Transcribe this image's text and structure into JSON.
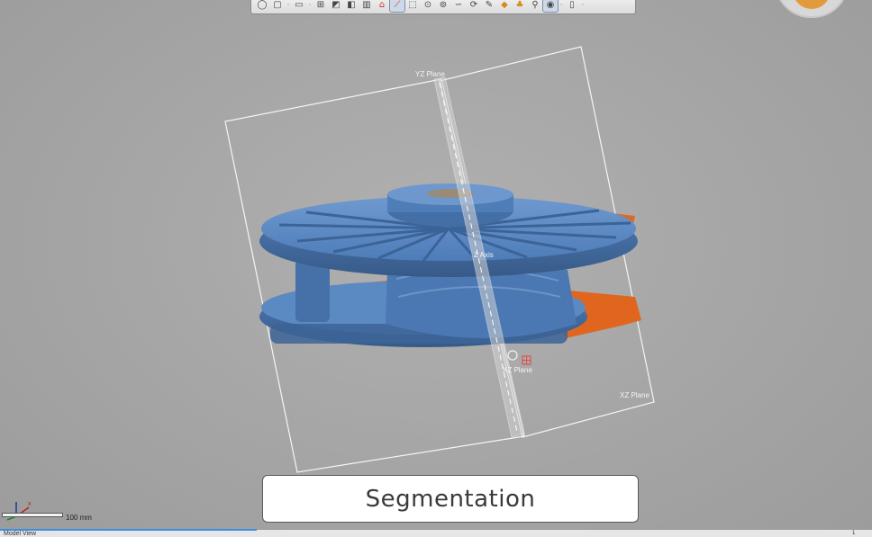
{
  "toolbar": {
    "buttons": [
      {
        "name": "sphere-view-icon",
        "glyph": "◯"
      },
      {
        "name": "cube-view-icon",
        "glyph": "▢"
      },
      {
        "name": "dropdown-dot",
        "glyph": "·"
      },
      {
        "name": "box-select-icon",
        "glyph": "▭"
      },
      {
        "name": "dropdown-dot",
        "glyph": "·"
      },
      {
        "name": "plane-view-icon",
        "glyph": "⊞"
      },
      {
        "name": "section-icon",
        "glyph": "◩"
      },
      {
        "name": "split-view-icon",
        "glyph": "◧"
      },
      {
        "name": "column-view-icon",
        "glyph": "▥"
      },
      {
        "name": "house-icon",
        "glyph": "⌂"
      },
      {
        "name": "slash-tool-icon",
        "glyph": "⟋"
      },
      {
        "name": "rect-select-icon",
        "glyph": "⬚"
      },
      {
        "name": "point-target-icon",
        "glyph": "⊙"
      },
      {
        "name": "circle-dot-icon",
        "glyph": "⊚"
      },
      {
        "name": "lasso-icon",
        "glyph": "∽"
      },
      {
        "name": "paint-brush-icon",
        "glyph": "⟳"
      },
      {
        "name": "pen-edit-icon",
        "glyph": "✎"
      },
      {
        "name": "fill-bucket-icon",
        "glyph": "◆"
      },
      {
        "name": "stamp-icon",
        "glyph": "♣"
      },
      {
        "name": "link-icon",
        "glyph": "⚲"
      },
      {
        "name": "eye-view-icon",
        "glyph": "◉"
      },
      {
        "name": "dropdown-dot",
        "glyph": "·"
      },
      {
        "name": "page-icon",
        "glyph": "▯"
      },
      {
        "name": "dropdown-dot",
        "glyph": "·"
      }
    ]
  },
  "viewport": {
    "plane_labels": {
      "yz": "YZ Plane",
      "xz_upper": "Z Axis",
      "xz_lower": "XZ Plane",
      "xz_right": "XZ Plane"
    }
  },
  "caption": "Segmentation",
  "scale": {
    "label": "100 mm"
  },
  "status": {
    "left": "Model View",
    "right": "1"
  },
  "colors": {
    "background": "#a6a6a6",
    "mesh_blue": "#5b89c2",
    "mesh_dark": "#3d6496",
    "mesh_orange": "#e0661f",
    "plane_line": "#f5f5f5"
  }
}
